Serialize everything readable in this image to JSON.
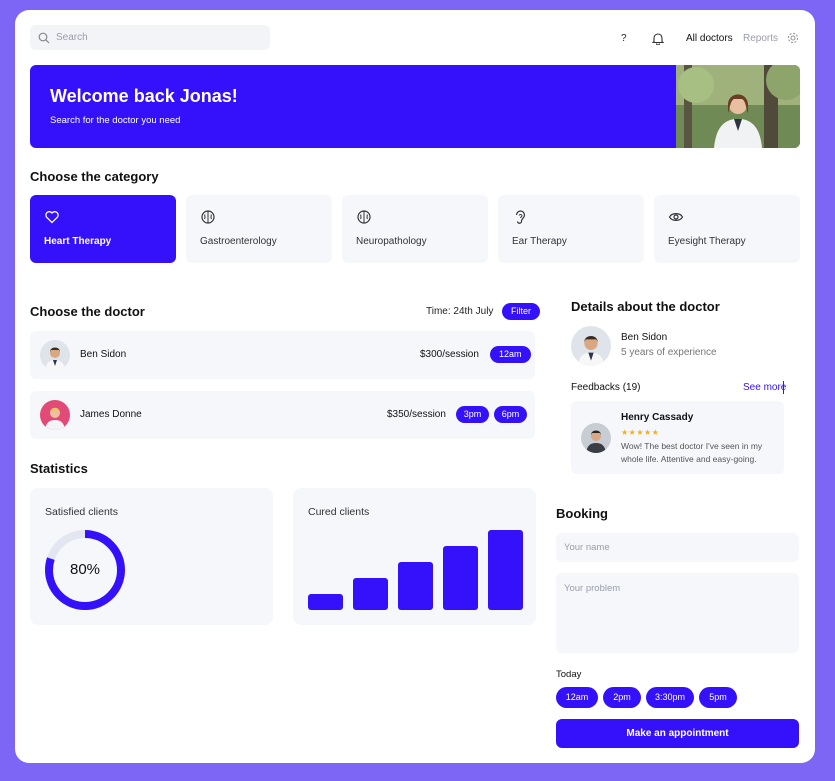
{
  "search": {
    "placeholder": "Search"
  },
  "nav": {
    "help": "?",
    "all_doctors": "All doctors",
    "reports": "Reports"
  },
  "hero": {
    "title": "Welcome back Jonas!",
    "subtitle": "Search for the doctor you need"
  },
  "categories": {
    "title": "Choose the category",
    "items": [
      {
        "label": "Heart Therapy",
        "icon": "heart-icon"
      },
      {
        "label": "Gastroenterology",
        "icon": "brain-icon"
      },
      {
        "label": "Neuropathology",
        "icon": "brain-icon"
      },
      {
        "label": "Ear Therapy",
        "icon": "ear-icon"
      },
      {
        "label": "Eyesight Therapy",
        "icon": "eye-icon"
      }
    ]
  },
  "doctors": {
    "title": "Choose the doctor",
    "time_label": "Time: 24th July",
    "filter_label": "Filter",
    "rows": [
      {
        "name": "Ben Sidon",
        "price": "$300/session",
        "slots": [
          "12am"
        ]
      },
      {
        "name": "James Donne",
        "price": "$350/session",
        "slots": [
          "3pm",
          "6pm"
        ]
      }
    ]
  },
  "statistics": {
    "title": "Statistics",
    "satisfied": {
      "title": "Satisfied clients",
      "value_label": "80%",
      "fraction": 0.8
    },
    "cured": {
      "title": "Cured clients",
      "bars": [
        0.2,
        0.4,
        0.6,
        0.8,
        1.0
      ]
    }
  },
  "details": {
    "title": "Details about the doctor",
    "name": "Ben Sidon",
    "experience": "5 years of experience",
    "feedbacks_label": "Feedbacks (19)",
    "see_more": "See more",
    "review": {
      "author": "Henry Cassady",
      "stars": "★★★★★",
      "text": "Wow! The best doctor I've seen in my whole life. Attentive and easy-going."
    }
  },
  "booking": {
    "title": "Booking",
    "name_placeholder": "Your name",
    "problem_placeholder": "Your problem",
    "today_label": "Today",
    "slots": [
      "12am",
      "2pm",
      "3:30pm",
      "5pm"
    ],
    "submit_label": "Make an appointment"
  },
  "colors": {
    "accent": "#3511fb",
    "background": "#7d66f6",
    "surface": "#f6f7fb"
  }
}
